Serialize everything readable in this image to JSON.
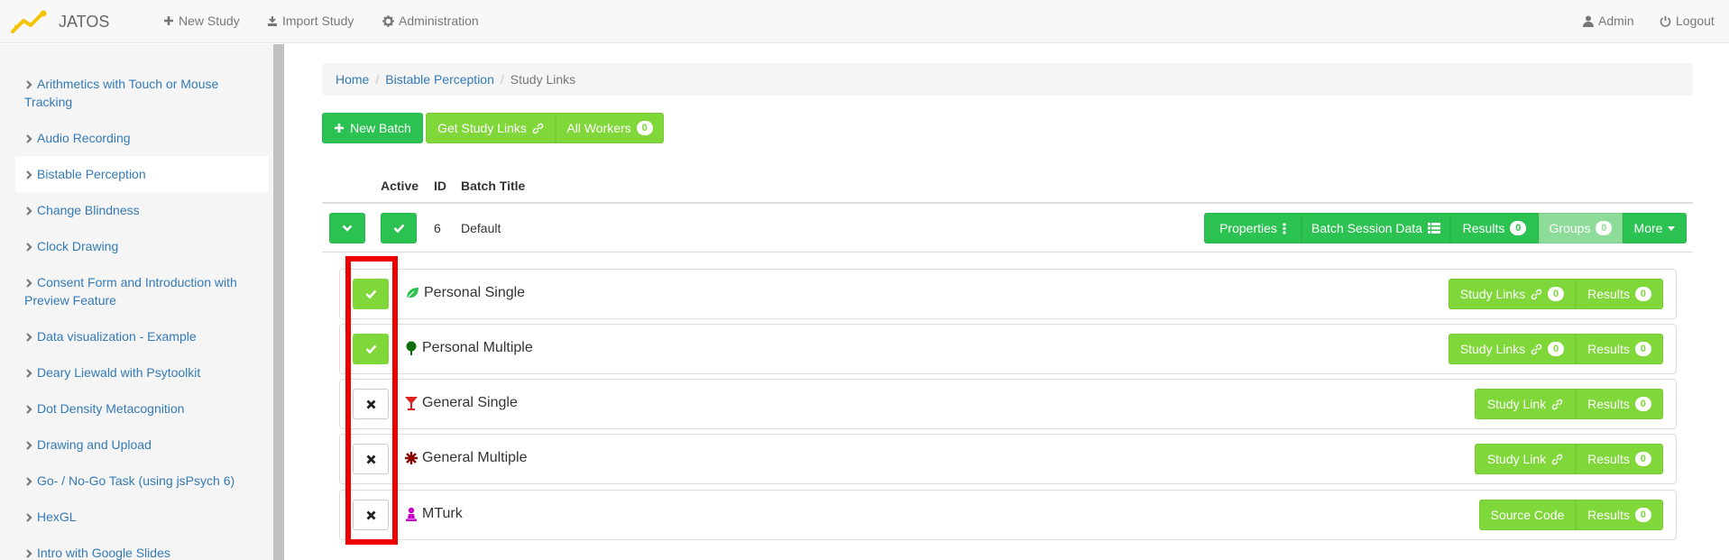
{
  "navbar": {
    "brand": "JATOS",
    "new_study": "New Study",
    "import_study": "Import Study",
    "administration": "Administration",
    "admin": "Admin",
    "logout": "Logout"
  },
  "sidebar": {
    "items": [
      {
        "label": "Arithmetics with Touch or Mouse Tracking"
      },
      {
        "label": "Audio Recording"
      },
      {
        "label": "Bistable Perception"
      },
      {
        "label": "Change Blindness"
      },
      {
        "label": "Clock Drawing"
      },
      {
        "label": "Consent Form and Introduction with Preview Feature"
      },
      {
        "label": "Data visualization - Example"
      },
      {
        "label": "Deary Liewald with Psytoolkit"
      },
      {
        "label": "Dot Density Metacognition"
      },
      {
        "label": "Drawing and Upload"
      },
      {
        "label": "Go- / No-Go Task (using jsPsych 6)"
      },
      {
        "label": "HexGL"
      },
      {
        "label": "Intro with Google Slides"
      }
    ],
    "active_item": "Bistable Perception"
  },
  "breadcrumb": {
    "home": "Home",
    "study": "Bistable Perception",
    "current": "Study Links"
  },
  "toolbar": {
    "new_batch": "New Batch",
    "get_study_links": "Get Study Links",
    "all_workers": "All Workers",
    "all_workers_count": "0"
  },
  "batch_table": {
    "headers": {
      "active": "Active",
      "id": "ID",
      "title": "Batch Title"
    },
    "batch": {
      "id": "6",
      "title": "Default",
      "properties": "Properties",
      "session_data": "Batch Session Data",
      "results": "Results",
      "results_count": "0",
      "groups": "Groups",
      "groups_count": "0",
      "more": "More"
    }
  },
  "study_link_types": [
    {
      "title": "Personal Single",
      "active": true,
      "action": "Study Links",
      "action_count": "0",
      "results": "Results",
      "results_count": "0",
      "icon": "leaf-icon",
      "icon_color": "#2cc252"
    },
    {
      "title": "Personal Multiple",
      "active": true,
      "action": "Study Links",
      "action_count": "0",
      "results": "Results",
      "results_count": "0",
      "icon": "tree-icon",
      "icon_color": "#0a6e0a"
    },
    {
      "title": "General Single",
      "active": false,
      "action": "Study Link",
      "results": "Results",
      "results_count": "0",
      "icon": "glass-icon",
      "icon_color": "#e02020"
    },
    {
      "title": "General Multiple",
      "active": false,
      "action": "Study Link",
      "results": "Results",
      "results_count": "0",
      "icon": "asterisk-icon",
      "icon_color": "#8b0000"
    },
    {
      "title": "MTurk",
      "active": false,
      "action": "Source Code",
      "results": "Results",
      "results_count": "0",
      "icon": "pawn-icon",
      "icon_color": "#cc00cc"
    }
  ],
  "colors": {
    "primary_green": "#2cc252",
    "lime_green": "#7fd739",
    "light_green": "#8edc99",
    "link_blue": "#337ab7",
    "highlight_red": "#ee0000"
  }
}
